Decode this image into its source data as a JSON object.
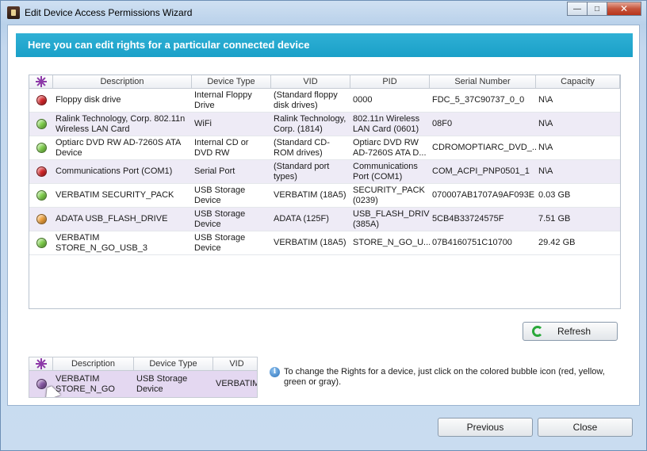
{
  "window": {
    "title": "Edit Device Access Permissions Wizard"
  },
  "banner": {
    "text": "Here you can edit rights for a particular connected device"
  },
  "table": {
    "columns": [
      "Description",
      "Device Type",
      "VID",
      "PID",
      "Serial Number",
      "Capacity"
    ],
    "rows": [
      {
        "status": "red",
        "description": "Floppy disk drive",
        "device_type": "Internal Floppy Drive",
        "vid": "(Standard floppy disk drives)",
        "pid": "0000",
        "serial": "FDC_5_37C90737_0_0",
        "capacity": "N\\A"
      },
      {
        "status": "green",
        "description": "Ralink Technology, Corp. 802.11n Wireless LAN Card",
        "device_type": "WiFi",
        "vid": "Ralink Technology, Corp. (1814)",
        "pid": "802.11n Wireless LAN Card (0601)",
        "serial": "08F0",
        "capacity": "N\\A"
      },
      {
        "status": "green",
        "description": "Optiarc DVD RW AD-7260S ATA Device",
        "device_type": "Internal CD or DVD RW",
        "vid": "(Standard CD-ROM drives)",
        "pid": "Optiarc DVD RW AD-7260S ATA D...",
        "serial": "CDROMOPTIARC_DVD_...",
        "capacity": "N\\A"
      },
      {
        "status": "red",
        "description": "Communications Port (COM1)",
        "device_type": "Serial Port",
        "vid": "(Standard port types)",
        "pid": "Communications Port (COM1)",
        "serial": "COM_ACPI_PNP0501_1",
        "capacity": "N\\A"
      },
      {
        "status": "green",
        "description": "VERBATIM SECURITY_PACK",
        "device_type": "USB Storage Device",
        "vid": "VERBATIM (18A5)",
        "pid": "SECURITY_PACK (0239)",
        "serial": "070007AB1707A9AF093E",
        "capacity": "0.03 GB"
      },
      {
        "status": "orange",
        "description": "ADATA USB_FLASH_DRIVE",
        "device_type": "USB Storage Device",
        "vid": "ADATA (125F)",
        "pid": "USB_FLASH_DRIVE (385A)",
        "serial": "5CB4B33724575F",
        "capacity": "7.51 GB"
      },
      {
        "status": "green",
        "description": "VERBATIM STORE_N_GO_USB_3",
        "device_type": "USB Storage Device",
        "vid": "VERBATIM (18A5)",
        "pid": "STORE_N_GO_U...",
        "serial": "07B4160751C10700",
        "capacity": "29.42 GB"
      }
    ]
  },
  "refresh_label": "Refresh",
  "demo": {
    "columns": [
      "Description",
      "Device Type",
      "VID"
    ],
    "row": {
      "status": "purple",
      "description": "VERBATIM STORE_N_GO",
      "device_type": "USB Storage Device",
      "vid": "VERBATIM"
    }
  },
  "info_text": "To change the Rights for a device, just click on the colored bubble icon (red, yellow, green or gray).",
  "buttons": {
    "previous": "Previous",
    "close": "Close"
  },
  "colors": {
    "red": "#d8262a",
    "green": "#7fd24a",
    "orange": "#f2a23a",
    "purple": "#8a5aa8",
    "banner": "#1fa5cc"
  },
  "icons": {
    "column_icon": "multi-star-icon",
    "info": "info-icon",
    "refresh": "refresh-icon"
  }
}
